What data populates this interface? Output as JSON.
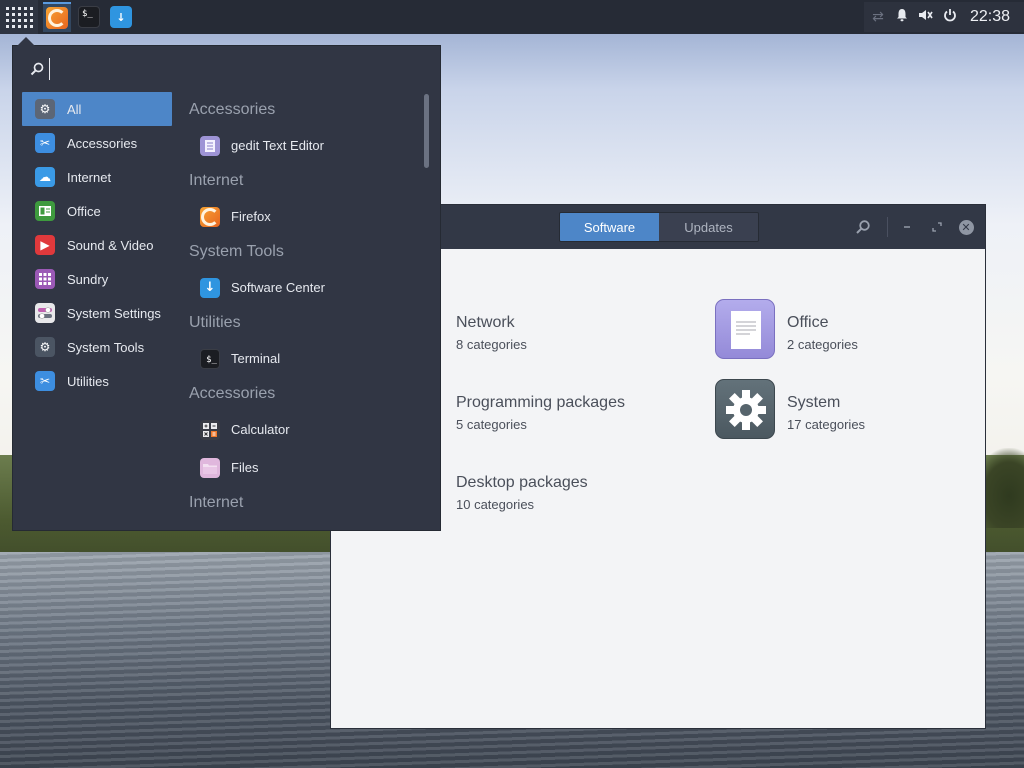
{
  "panel": {
    "apps_button_icon": "app-grid-icon",
    "tasks": [
      {
        "name": "Firefox",
        "icon": "firefox-icon",
        "active": true
      },
      {
        "name": "Terminal",
        "icon": "terminal-icon",
        "glyph": "$_",
        "active": false
      },
      {
        "name": "Software Center",
        "icon": "download-arrow-icon",
        "glyph": "↓",
        "active": false
      }
    ],
    "tray": {
      "network_icon": "network-arrows-icon",
      "notification_icon": "bell-icon",
      "volume_icon": "volume-muted-icon",
      "power_icon": "power-icon",
      "clock": "22:38"
    }
  },
  "menu": {
    "search": {
      "value": "",
      "placeholder": ""
    },
    "categories": [
      {
        "label": "All",
        "icon": "gear-icon",
        "color": "#5c6676",
        "selected": true
      },
      {
        "label": "Accessories",
        "icon": "scissors-icon",
        "color": "#3d8ee0"
      },
      {
        "label": "Internet",
        "icon": "cloud-icon",
        "color": "#3a9ae6"
      },
      {
        "label": "Office",
        "icon": "document-icon",
        "color": "#3e9a3e"
      },
      {
        "label": "Sound & Video",
        "icon": "play-icon",
        "color": "#e0393c"
      },
      {
        "label": "Sundry",
        "icon": "grid-icon",
        "color": "#9b59b6"
      },
      {
        "label": "System Settings",
        "icon": "toggles-icon",
        "color": "#e8e8ea"
      },
      {
        "label": "System Tools",
        "icon": "gear-icon",
        "color": "#4b5563"
      },
      {
        "label": "Utilities",
        "icon": "scissors-icon",
        "color": "#3d8ee0"
      }
    ],
    "apps": [
      {
        "section": "Accessories",
        "label": "gedit Text Editor",
        "icon": "text-editor-icon"
      },
      {
        "section": "Internet",
        "label": "Firefox",
        "icon": "firefox-icon"
      },
      {
        "section": "System Tools",
        "label": "Software Center",
        "icon": "download-arrow-icon"
      },
      {
        "section": "Utilities",
        "label": "Terminal",
        "icon": "terminal-icon"
      },
      {
        "section": "Accessories",
        "label": "Calculator",
        "icon": "calculator-icon"
      },
      {
        "section": "",
        "label": "Files",
        "icon": "folder-icon"
      },
      {
        "section": "Internet",
        "label": "",
        "icon": ""
      }
    ]
  },
  "software_center": {
    "tabs": [
      {
        "label": "Software",
        "selected": true
      },
      {
        "label": "Updates",
        "selected": false
      }
    ],
    "header_icons": [
      "search-icon",
      "minimize-icon",
      "maximize-icon",
      "close-icon"
    ],
    "categories": [
      {
        "name": "Network",
        "count": "8 categories",
        "icon": "network-icon",
        "color": "#4a5aa8"
      },
      {
        "name": "Office",
        "count": "2 categories",
        "icon": "office-document-icon",
        "color": "#a7a0e4"
      },
      {
        "name": "Programming packages",
        "count": "5 categories",
        "icon": "programming-icon",
        "color": "#e1c23a"
      },
      {
        "name": "System",
        "count": "17 categories",
        "icon": "gear-icon",
        "color": "#56646c"
      },
      {
        "name": "Desktop packages",
        "count": "10 categories",
        "icon": "desktop-icon",
        "color": "#2f95e0"
      }
    ]
  }
}
